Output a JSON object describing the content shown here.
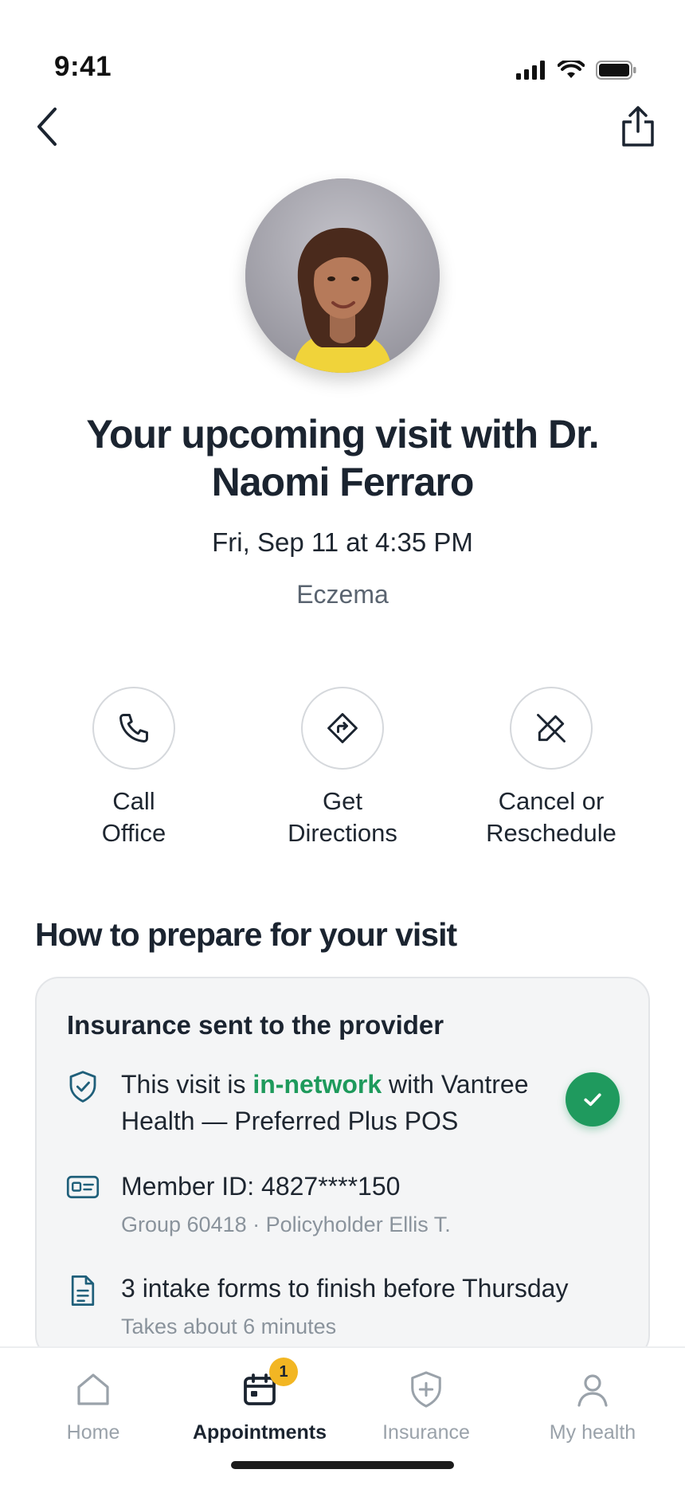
{
  "status": {
    "time": "9:41"
  },
  "doctor": {
    "photo_icon": "doctor-portrait",
    "heading": "Your upcoming visit with Dr. Naomi Ferraro",
    "datetime": "Fri, Sep 11 at 4:35 PM",
    "reason": "Eczema"
  },
  "actions": [
    {
      "label": "Call\nOffice",
      "icon": "phone-icon"
    },
    {
      "label": "Get\nDirections",
      "icon": "directions-icon"
    },
    {
      "label": "Cancel or\nReschedule",
      "icon": "cancel-pen-icon"
    }
  ],
  "prepare": {
    "section_title": "How to prepare for your visit",
    "card": {
      "title": "Insurance sent to the provider",
      "network": {
        "prefix": "This visit is ",
        "highlight": "in-network",
        "suffix": " with Vantree Health — Preferred Plus POS"
      },
      "member": {
        "text": "Member ID: 4827****150",
        "sub": "Group 60418 · Policyholder Ellis T."
      },
      "forms": {
        "text": "3 intake forms to finish before Thursday",
        "sub": "Takes about 6 minutes"
      }
    }
  },
  "tabs": [
    {
      "label": "Home",
      "icon": "home-icon",
      "active": false
    },
    {
      "label": "Appointments",
      "icon": "calendar-icon",
      "active": true,
      "badge": "1"
    },
    {
      "label": "Insurance",
      "icon": "shield-plus-icon",
      "active": false
    },
    {
      "label": "My health",
      "icon": "person-icon",
      "active": false
    }
  ],
  "colors": {
    "accent_green": "#1f9a5e",
    "badge_yellow": "#f2b623",
    "icon_teal": "#1f5f7a"
  }
}
